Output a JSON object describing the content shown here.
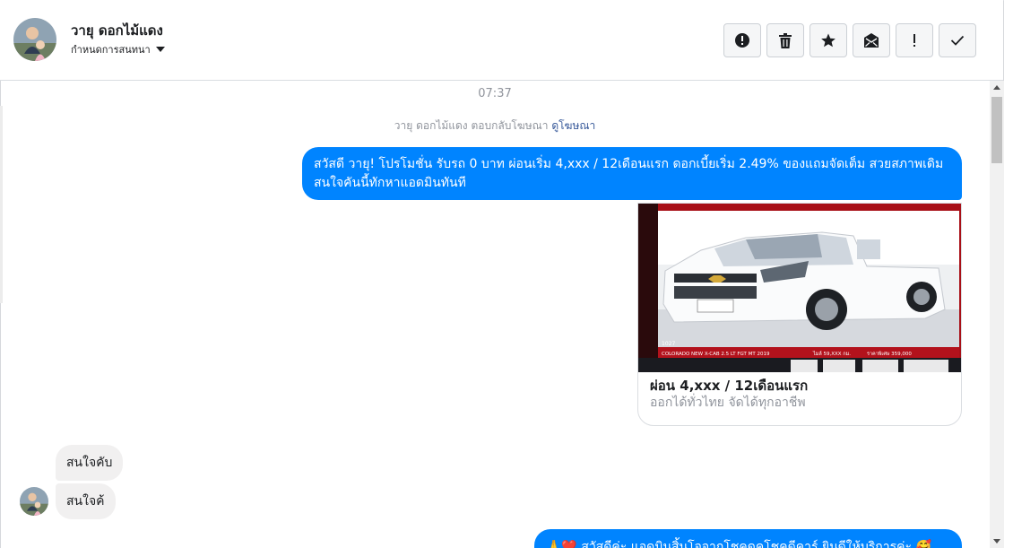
{
  "header": {
    "contact_name": "วายุ ดอกไม้แดง",
    "assign_label": "กำหนดการสนทนา",
    "actions": [
      {
        "name": "mark-spam",
        "icon": "alert-circle-icon"
      },
      {
        "name": "delete",
        "icon": "trash-icon"
      },
      {
        "name": "star",
        "icon": "star-icon"
      },
      {
        "name": "mark-unread",
        "icon": "envelope-icon"
      },
      {
        "name": "important",
        "icon": "exclamation-icon"
      },
      {
        "name": "mark-done",
        "icon": "check-icon"
      }
    ]
  },
  "chat": {
    "timestamp": "07:37",
    "reply_info": {
      "text": "วายุ ดอกไม้แดง ตอบกลับโฆษณา",
      "link": "ดูโฆษณา"
    },
    "messages": [
      {
        "direction": "outgoing",
        "text": "สวัสดี วายุ! โปรโมชั่น รับรถ 0 บาท ผ่อนเริ่ม 4,xxx / 12เดือนแรก ดอกเบี้ยเริ่ม 2.49% ของแถมจัดเต็ม สวยสภาพเดิม สนใจคันนี้ทักหาแอดมินทันที"
      },
      {
        "direction": "outgoing",
        "type": "card",
        "title": "ผ่อน 4,xxx / 12เดือนแรก",
        "subtitle": "ออกได้ทั่วไทย จัดได้ทุกอาชีพ",
        "image_text": {
          "stock_no": "1027",
          "model": "COLORADO NEW X-CAB 2.5 LT FGT MT 2019",
          "mileage": "ไมล์ 59,XXX กม.",
          "price": "ราคาพิเศษ 359,000"
        }
      },
      {
        "direction": "incoming",
        "text": "สนใจคับ"
      },
      {
        "direction": "incoming",
        "text": "สนใจค้"
      },
      {
        "direction": "outgoing",
        "text": "🙏❤️ สวัสดีค่ะ แอดมินสิ้นโจจากโชคดูคโชคดีคาร์ ยินดีให้บริการค่ะ 🥰"
      }
    ]
  },
  "colors": {
    "outgoing_bubble": "#0084ff",
    "incoming_bubble": "#f1f0f0",
    "card_banner": "#b3121c"
  }
}
